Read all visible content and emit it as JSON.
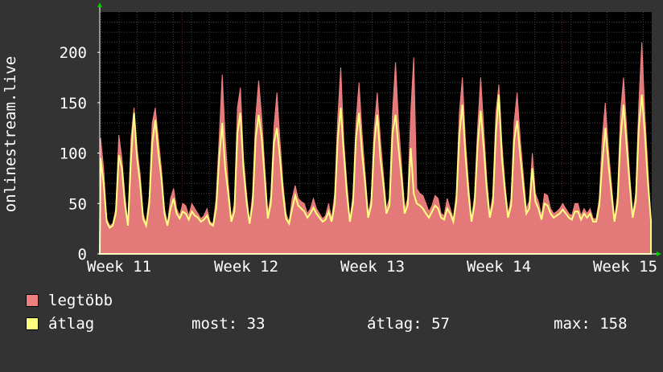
{
  "colors": {
    "background": "#333333",
    "plot_background": "#000000",
    "grid": "#444444",
    "week_grid": "#662222",
    "max_color": "#f08080",
    "avg_color": "#ffff80"
  },
  "chart_data": {
    "type": "area",
    "ylabel": "onlinestream.live",
    "y_ticks": [
      "0",
      "50",
      "100",
      "150",
      "200"
    ],
    "ylim": [
      0,
      240
    ],
    "x_ticks": [
      "Week 11",
      "Week 12",
      "Week 13",
      "Week 14",
      "Week 15"
    ],
    "grid": true,
    "legend_placement": "bottom-left",
    "series": [
      {
        "name": "legtöbb",
        "color": "#f08080",
        "values": [
          115,
          85,
          35,
          28,
          30,
          45,
          118,
          95,
          58,
          30,
          115,
          145,
          105,
          80,
          40,
          30,
          58,
          130,
          145,
          115,
          85,
          45,
          30,
          55,
          65,
          45,
          38,
          50,
          48,
          38,
          50,
          45,
          40,
          35,
          38,
          45,
          32,
          30,
          55,
          115,
          178,
          115,
          70,
          35,
          50,
          145,
          165,
          95,
          60,
          32,
          60,
          135,
          172,
          135,
          85,
          40,
          58,
          125,
          160,
          112,
          70,
          40,
          32,
          55,
          68,
          55,
          52,
          50,
          40,
          45,
          55,
          45,
          40,
          35,
          38,
          50,
          35,
          60,
          135,
          185,
          112,
          70,
          35,
          58,
          130,
          170,
          120,
          80,
          40,
          55,
          125,
          160,
          115,
          80,
          45,
          55,
          140,
          190,
          130,
          88,
          45,
          55,
          140,
          195,
          65,
          60,
          58,
          50,
          42,
          48,
          58,
          55,
          40,
          38,
          55,
          45,
          35,
          60,
          140,
          175,
          112,
          70,
          35,
          58,
          125,
          175,
          125,
          75,
          40,
          58,
          140,
          168,
          110,
          70,
          40,
          55,
          130,
          160,
          115,
          80,
          45,
          52,
          100,
          60,
          52,
          38,
          60,
          58,
          45,
          40,
          42,
          45,
          50,
          45,
          40,
          38,
          50,
          50,
          38,
          45,
          40,
          45,
          35,
          35,
          55,
          115,
          150,
          105,
          70,
          35,
          58,
          140,
          175,
          125,
          80,
          40,
          60,
          148,
          210,
          140,
          85,
          33
        ]
      },
      {
        "name": "átlag",
        "color": "#ffff80",
        "values": [
          95,
          70,
          32,
          26,
          28,
          40,
          98,
          85,
          50,
          28,
          95,
          140,
          95,
          70,
          35,
          28,
          50,
          110,
          133,
          100,
          75,
          40,
          28,
          45,
          55,
          40,
          35,
          42,
          40,
          34,
          42,
          38,
          36,
          32,
          34,
          38,
          30,
          28,
          45,
          95,
          130,
          85,
          60,
          32,
          42,
          120,
          140,
          85,
          52,
          30,
          50,
          115,
          138,
          115,
          75,
          35,
          50,
          110,
          125,
          95,
          60,
          35,
          30,
          45,
          58,
          48,
          45,
          42,
          36,
          40,
          46,
          40,
          36,
          32,
          34,
          42,
          32,
          50,
          115,
          145,
          100,
          60,
          32,
          50,
          115,
          140,
          100,
          70,
          36,
          48,
          110,
          138,
          95,
          70,
          40,
          48,
          120,
          138,
          105,
          75,
          40,
          48,
          105,
          60,
          50,
          48,
          45,
          40,
          36,
          42,
          48,
          45,
          36,
          34,
          45,
          40,
          32,
          52,
          118,
          148,
          98,
          60,
          32,
          50,
          108,
          142,
          105,
          65,
          36,
          50,
          120,
          158,
          95,
          62,
          36,
          48,
          112,
          132,
          98,
          68,
          40,
          45,
          85,
          52,
          45,
          34,
          50,
          48,
          40,
          36,
          38,
          40,
          44,
          40,
          36,
          34,
          42,
          42,
          34,
          40,
          36,
          40,
          32,
          32,
          48,
          90,
          125,
          90,
          60,
          32,
          50,
          115,
          148,
          108,
          70,
          36,
          52,
          125,
          158,
          120,
          72,
          33
        ]
      }
    ]
  },
  "legend": {
    "items": [
      {
        "label": "legtöbb",
        "color": "#f08080"
      },
      {
        "label": "átlag",
        "color": "#ffff80"
      }
    ]
  },
  "stats": {
    "now": "most: 33",
    "avg": "átlag: 57",
    "max": "max: 158"
  }
}
